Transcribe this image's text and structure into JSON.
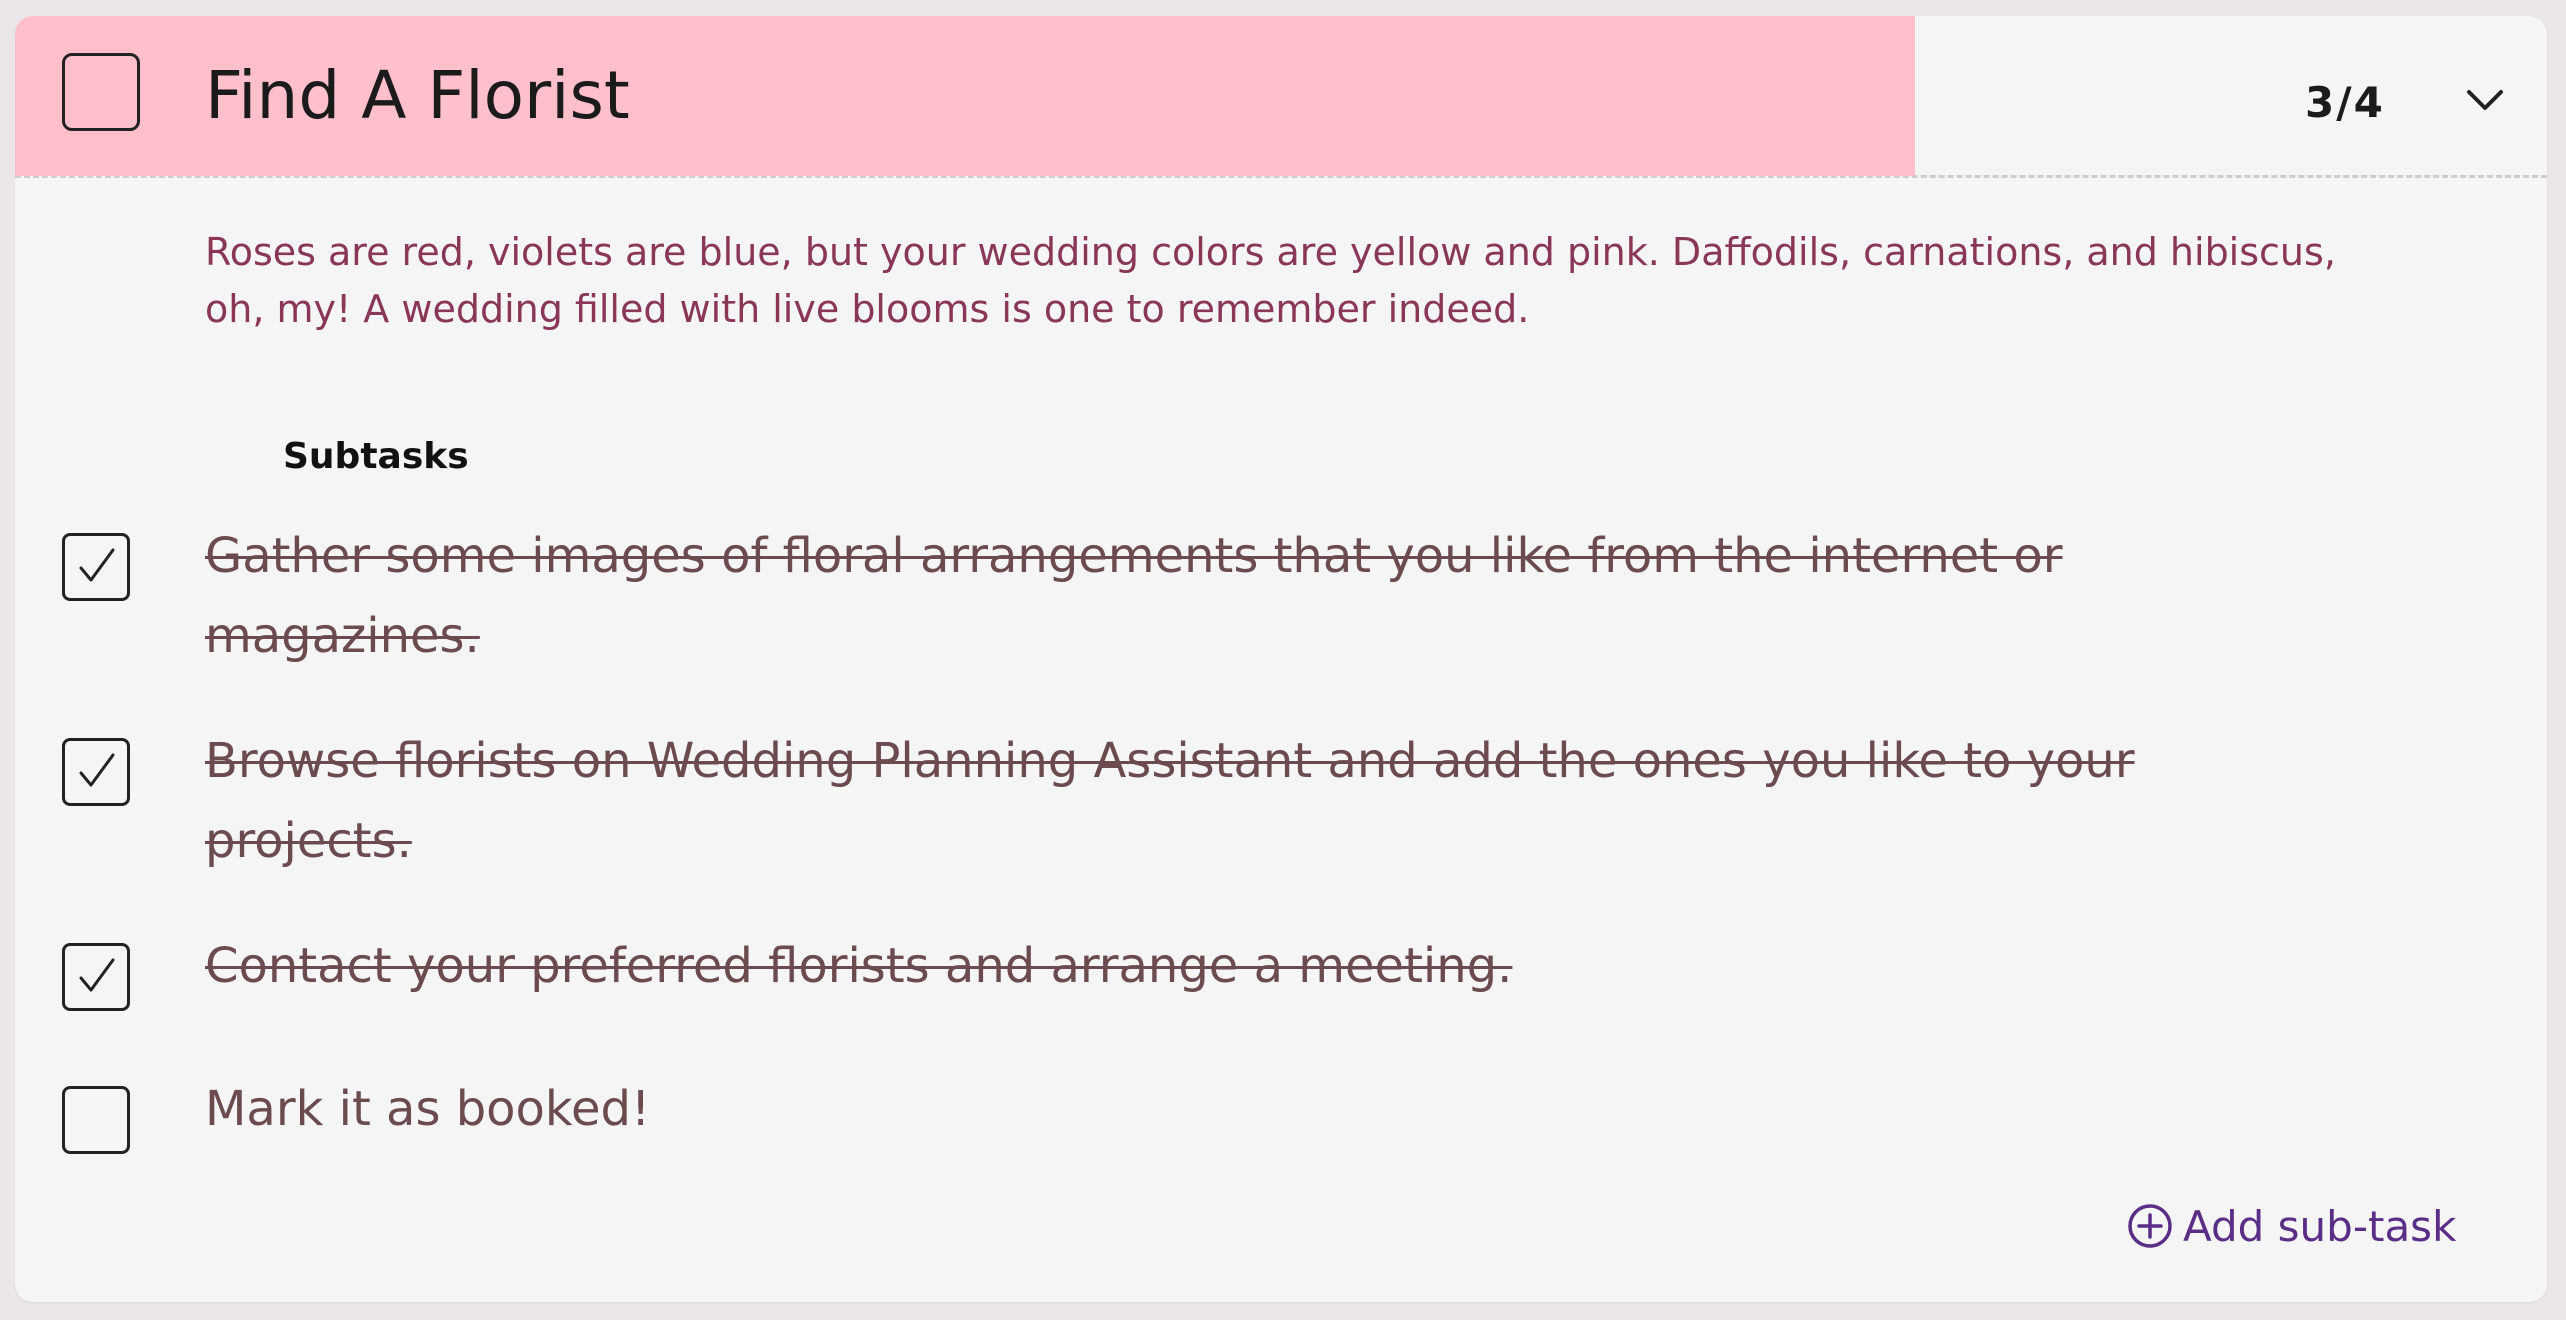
{
  "task": {
    "title": "Find A Florist",
    "progress": "3/4",
    "progress_fraction": 0.75,
    "completed": false,
    "description": "Roses are red, violets are blue, but your wedding colors are yellow and pink. Daffodils, carnations, and hibiscus, oh, my! A wedding filled with live blooms is one to remember indeed."
  },
  "subtasks": {
    "heading": "Subtasks",
    "items": [
      {
        "label": "Gather some images of floral arrangements that you like from the internet or magazines.",
        "checked": true
      },
      {
        "label": "Browse florists on Wedding Planning Assistant and add the ones you like to your projects.",
        "checked": true
      },
      {
        "label": "Contact your preferred florists and arrange a meeting.",
        "checked": true
      },
      {
        "label": "Mark it as booked!",
        "checked": false
      }
    ]
  },
  "actions": {
    "add_subtask": "Add sub-task"
  },
  "icons": {
    "expand": "chevron-down-icon",
    "add": "plus-circle-icon",
    "check": "checkmark-icon"
  },
  "colors": {
    "header_fill": "#ffc0cb",
    "description": "#8a3656",
    "subtask_text": "#6b4b4d",
    "accent": "#5a2d86"
  }
}
